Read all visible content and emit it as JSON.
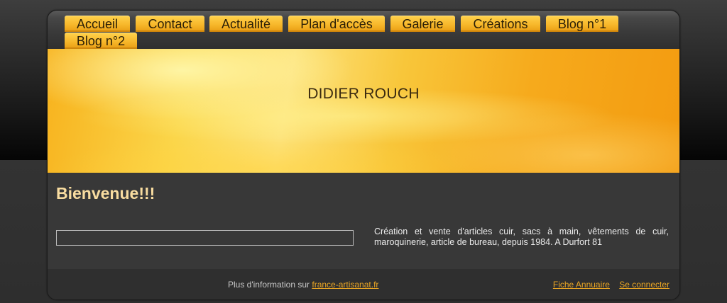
{
  "nav": {
    "items": [
      {
        "label": "Accueil"
      },
      {
        "label": "Contact"
      },
      {
        "label": "Actualité"
      },
      {
        "label": "Plan d'accès"
      },
      {
        "label": "Galerie"
      },
      {
        "label": "Créations"
      },
      {
        "label": "Blog n°1"
      },
      {
        "label": "Blog n°2"
      }
    ]
  },
  "banner": {
    "title": "DIDIER ROUCH"
  },
  "main": {
    "heading": "Bienvenue!!!",
    "description": "Création et vente d'articles cuir, sacs à main, vêtements de cuir, maroquinerie, article de bureau, depuis 1984. A Durfort 81"
  },
  "footer": {
    "info_prefix": "Plus d'information sur",
    "info_link": "france-artisanat.fr",
    "directory_link": "Fiche Annuaire",
    "login_link": "Se connecter"
  },
  "colors": {
    "accent": "#f7b72a",
    "heading": "#f8dca0",
    "link": "#e9a524",
    "background": "#3a3a3a"
  }
}
